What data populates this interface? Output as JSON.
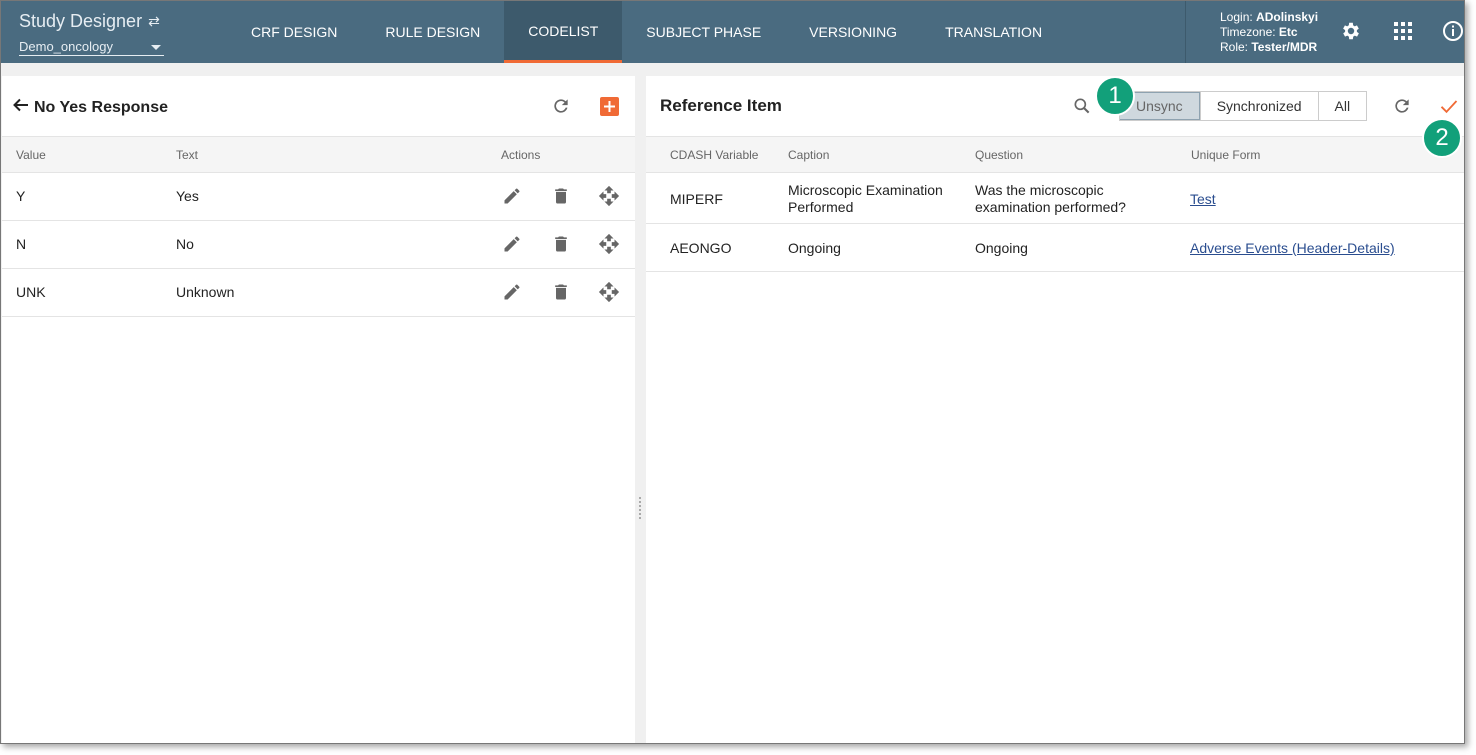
{
  "header": {
    "app_title": "Study Designer",
    "study_name": "Demo_oncology",
    "tabs": [
      {
        "label": "CRF DESIGN"
      },
      {
        "label": "RULE DESIGN"
      },
      {
        "label": "CODELIST"
      },
      {
        "label": "SUBJECT PHASE"
      },
      {
        "label": "VERSIONING"
      },
      {
        "label": "TRANSLATION"
      }
    ],
    "active_tab": "CODELIST",
    "user": {
      "login_label": "Login:",
      "login": "ADolinskyi",
      "timezone_label": "Timezone:",
      "timezone": "Etc",
      "role_label": "Role:",
      "role": "Tester/MDR"
    },
    "icons": [
      "settings-icon",
      "apps-grid-icon",
      "info-icon"
    ]
  },
  "left_panel": {
    "title": "No Yes Response",
    "columns": [
      "Value",
      "Text",
      "Actions"
    ],
    "rows": [
      {
        "value": "Y",
        "text": "Yes"
      },
      {
        "value": "N",
        "text": "No"
      },
      {
        "value": "UNK",
        "text": "Unknown"
      }
    ]
  },
  "right_panel": {
    "title": "Reference Item",
    "filters": [
      "Unsync",
      "Synchronized",
      "All"
    ],
    "active_filter": "Unsync",
    "columns": [
      "CDASH Variable",
      "Caption",
      "Question",
      "Unique Form"
    ],
    "rows": [
      {
        "variable": "MIPERF",
        "caption": "Microscopic Examination Performed",
        "question": "Was the microscopic examination performed?",
        "form": "Test"
      },
      {
        "variable": "AEONGO",
        "caption": "Ongoing",
        "question": "Ongoing",
        "form": "Adverse Events (Header-Details)"
      }
    ]
  },
  "callouts": [
    "1",
    "2"
  ],
  "colors": {
    "header_bg": "#4a6b80",
    "accent": "#f06a35",
    "callout": "#12a07a",
    "link": "#2a4d8f"
  }
}
